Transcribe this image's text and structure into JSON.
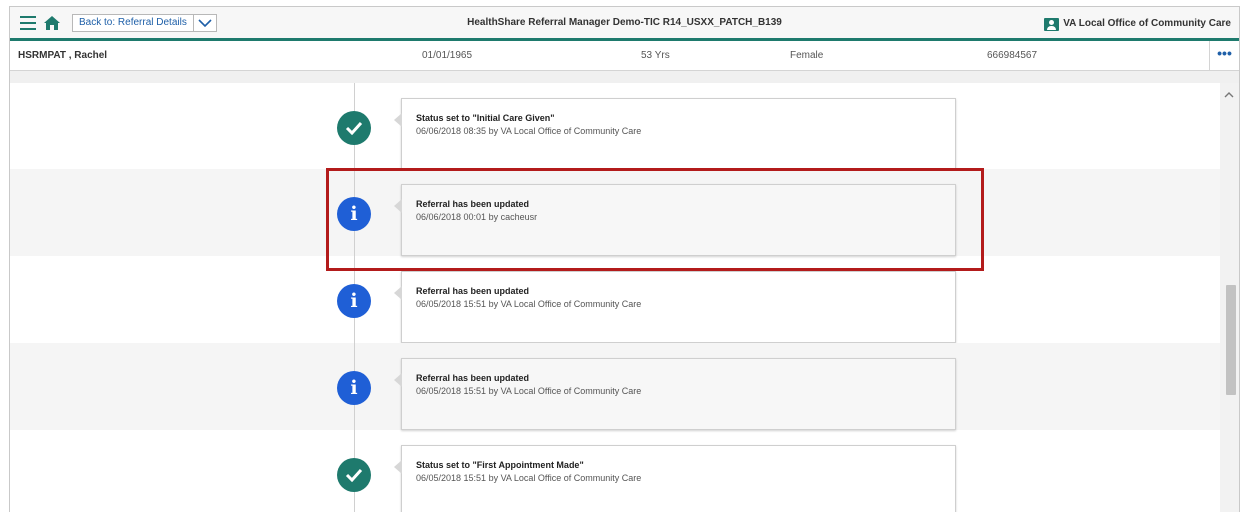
{
  "header": {
    "back_label": "Back to: Referral Details",
    "app_title": "HealthShare Referral Manager Demo-TIC R14_USXX_PATCH_B139",
    "office_label": "VA Local Office of Community Care"
  },
  "patient": {
    "name": "HSRMPAT , Rachel",
    "dob": "01/01/1965",
    "age": "53 Yrs",
    "sex": "Female",
    "id": "666984567",
    "more_label": "•••"
  },
  "timeline": [
    {
      "type": "check",
      "title": "Status set to \"Initial Care Given\"",
      "subtitle": "06/06/2018 08:35 by VA Local Office of Community Care"
    },
    {
      "type": "info",
      "title": "Referral has been updated",
      "subtitle": "06/06/2018 00:01 by cacheusr"
    },
    {
      "type": "info",
      "title": "Referral has been updated",
      "subtitle": "06/05/2018 15:51 by VA Local Office of Community Care"
    },
    {
      "type": "info",
      "title": "Referral has been updated",
      "subtitle": "06/05/2018 15:51 by VA Local Office of Community Care"
    },
    {
      "type": "check",
      "title": "Status set to \"First Appointment Made\"",
      "subtitle": "06/05/2018 15:51 by VA Local Office of Community Care"
    }
  ],
  "icons": {
    "menu": "hamburger-icon",
    "home": "home-icon",
    "dropdown": "chevron-down-icon",
    "office": "user-card-icon",
    "check": "check-icon",
    "info": "info-icon",
    "scroll_up": "chevron-up-icon"
  },
  "colors": {
    "accent": "#1e7a6d",
    "info": "#1f5fd6",
    "highlight": "#b31b1b",
    "link": "#1e5fa8"
  }
}
